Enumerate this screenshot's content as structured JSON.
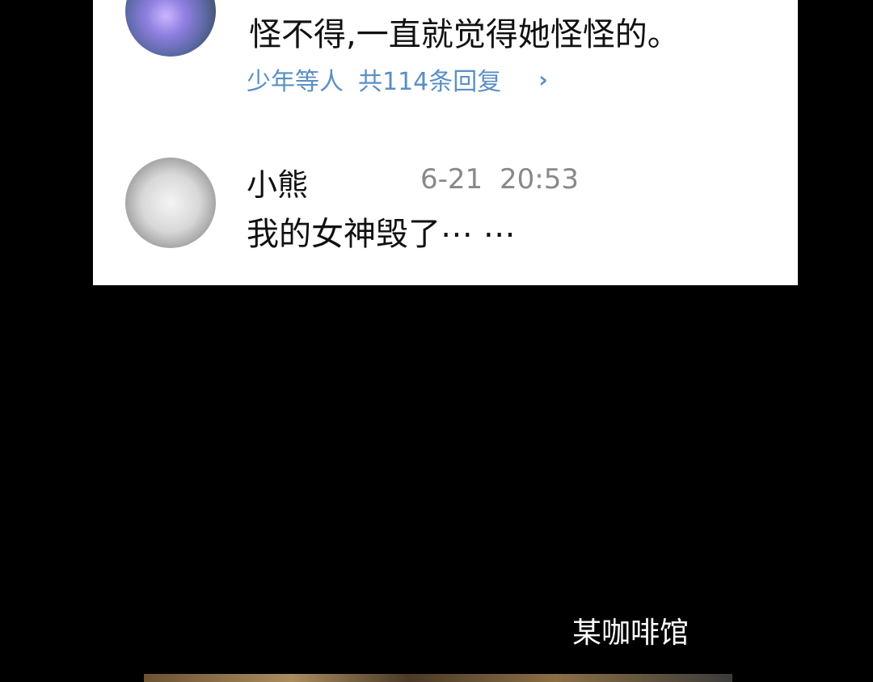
{
  "comments": [
    {
      "avatar_icon": "flower-avatar",
      "text": "怪不得,一直就觉得她怪怪的。",
      "replies": {
        "users": "少年等人",
        "count": "共114条回复",
        "chevron": "›"
      }
    },
    {
      "avatar_icon": "dog-avatar",
      "username": "小熊",
      "time": "6-21 20:53",
      "text": "我的女神毁了⋯ ⋯"
    }
  ],
  "caption": "某咖啡馆",
  "colors": {
    "background": "#000000",
    "card": "#ffffff",
    "reply_link": "#5b8fc4",
    "timestamp": "#888888"
  }
}
